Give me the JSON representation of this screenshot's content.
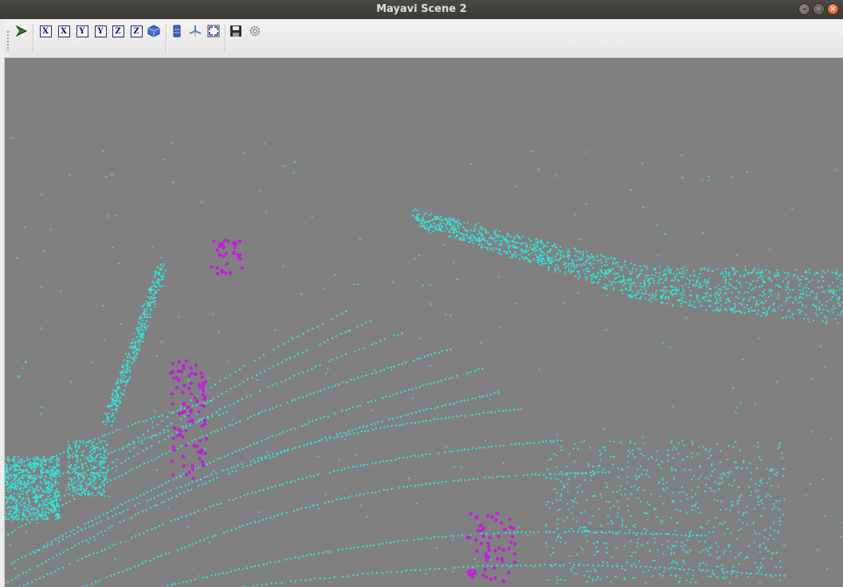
{
  "window": {
    "title": "Mayavi Scene 2",
    "controls": [
      "minimize",
      "maximize",
      "close"
    ]
  },
  "toolbar": {
    "buttons": [
      {
        "name": "mayavi-pipeline-icon",
        "glyph": "➢"
      },
      {
        "name": "view-x-plus-icon",
        "glyph": "X"
      },
      {
        "name": "view-x-minus-icon",
        "glyph": "X"
      },
      {
        "name": "view-y-plus-icon",
        "glyph": "Y"
      },
      {
        "name": "view-y-minus-icon",
        "glyph": "Y"
      },
      {
        "name": "view-z-plus-icon",
        "glyph": "Z"
      },
      {
        "name": "view-z-minus-icon",
        "glyph": "Z"
      },
      {
        "name": "isometric-view-icon",
        "glyph": "cube"
      },
      {
        "name": "toggle-parallel-projection-icon",
        "glyph": "bar"
      },
      {
        "name": "toggle-axes-indicator-icon",
        "glyph": "axes"
      },
      {
        "name": "full-screen-icon",
        "glyph": "fullscreen"
      },
      {
        "name": "save-icon",
        "glyph": "disk"
      },
      {
        "name": "configure-scene-icon",
        "glyph": "gear"
      }
    ]
  },
  "scene": {
    "background_color": "#808080",
    "point_color": "#2ee6dc",
    "highlight_color": "#c21fd8"
  }
}
